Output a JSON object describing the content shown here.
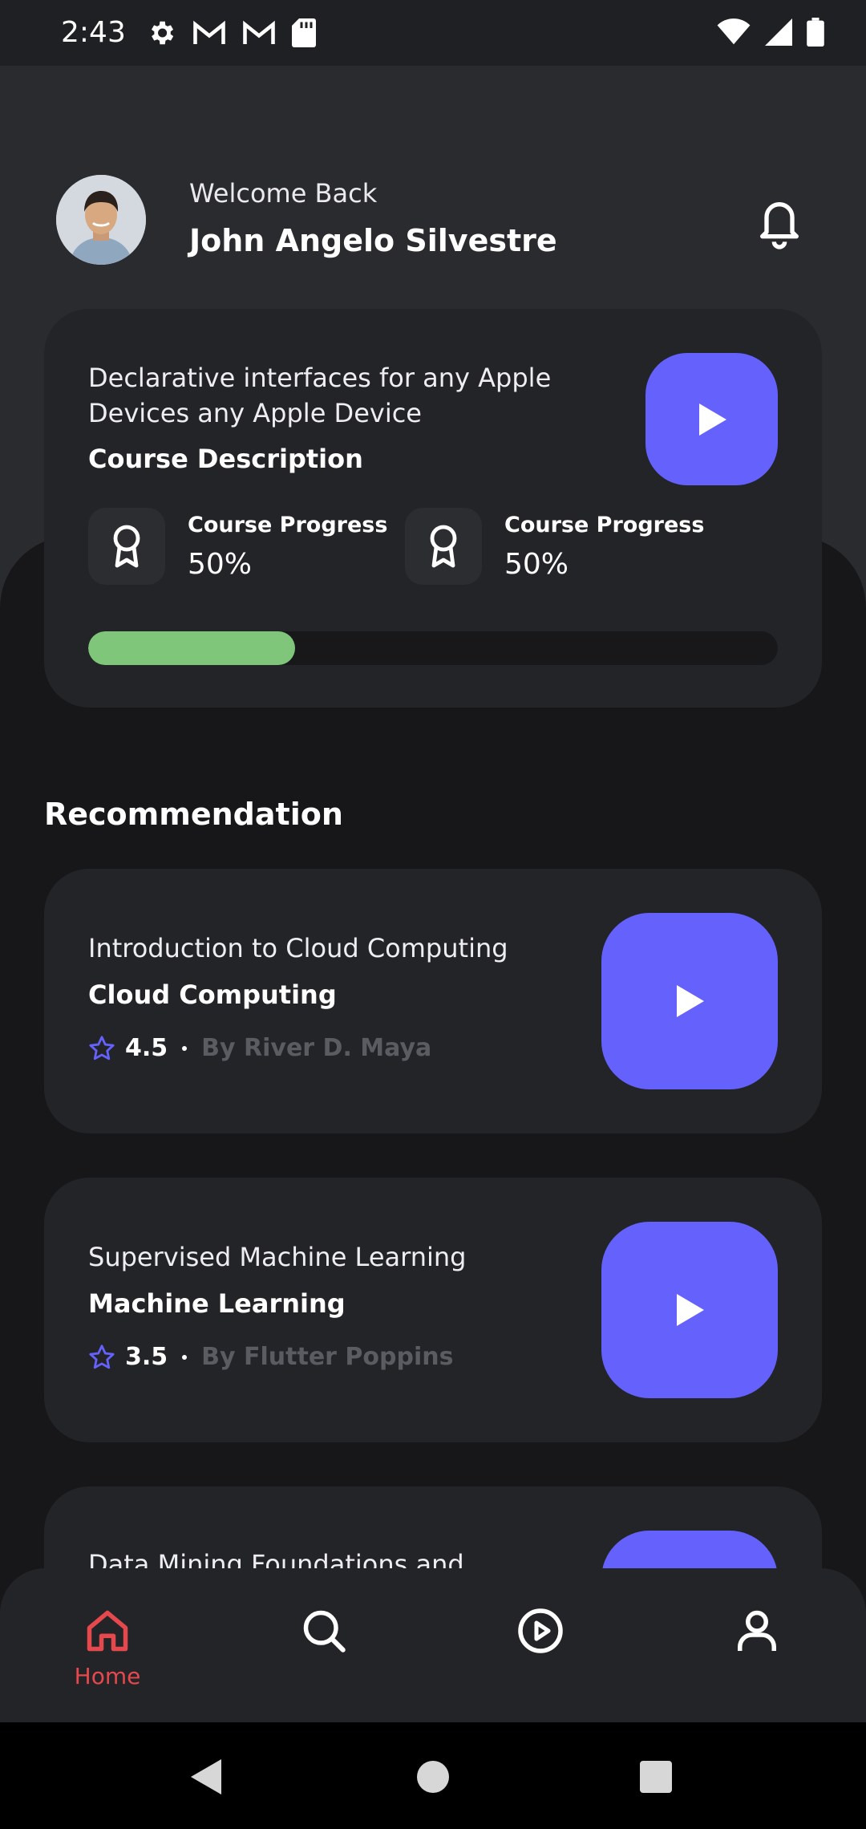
{
  "status_bar": {
    "time": "2:43",
    "left_icons": [
      "gear-icon",
      "gmail-icon",
      "gmail-icon",
      "sd-card-icon"
    ],
    "right_icons": [
      "wifi-icon",
      "signal-icon",
      "battery-icon"
    ]
  },
  "header": {
    "welcome": "Welcome Back",
    "user_name": "John Angelo Silvestre"
  },
  "current_course": {
    "title": "Declarative interfaces for any Apple Devices any Apple Device",
    "description_label": "Course Description",
    "progress_blocks": [
      {
        "label": "Course Progress",
        "value": "50%"
      },
      {
        "label": "Course Progress",
        "value": "50%"
      }
    ],
    "progress_fraction": 0.3,
    "progress_color": "#7fc57a"
  },
  "recommendation": {
    "title": "Recommendation",
    "items": [
      {
        "title": "Introduction to Cloud Computing",
        "subtitle": "Cloud Computing",
        "rating": "4.5",
        "author": "By River D. Maya"
      },
      {
        "title": "Supervised Machine Learning",
        "subtitle": "Machine Learning",
        "rating": "3.5",
        "author": "By Flutter Poppins"
      },
      {
        "title": "Data Mining Foundations and",
        "subtitle": "",
        "rating": "",
        "author": ""
      }
    ]
  },
  "bottom_nav": {
    "items": [
      {
        "label": "Home",
        "icon": "home-icon",
        "active": true
      },
      {
        "label": "",
        "icon": "search-icon",
        "active": false
      },
      {
        "label": "",
        "icon": "play-circle-icon",
        "active": false
      },
      {
        "label": "",
        "icon": "user-icon",
        "active": false
      }
    ]
  },
  "colors": {
    "accent": "#6461fc",
    "active_nav": "#e5484d",
    "card": "#232428",
    "background": "#17171a"
  }
}
